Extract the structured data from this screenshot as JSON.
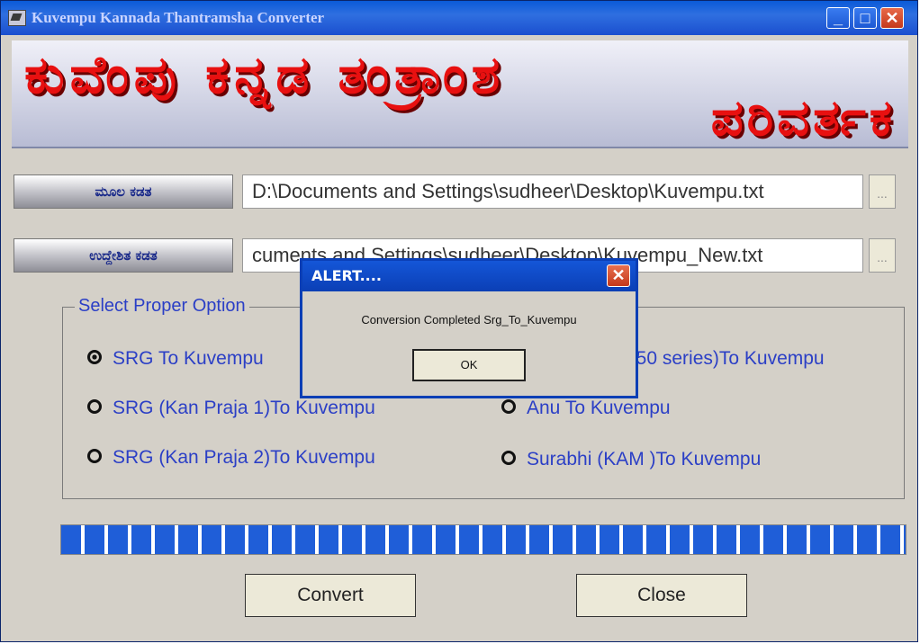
{
  "window": {
    "title": "Kuvempu Kannada Thantramsha Converter",
    "min_icon": "_",
    "max_icon": "□",
    "close_icon": "✕"
  },
  "banner": {
    "line1": "ಕುವೆಂಪು ಕನ್ನಡ ತಂತ್ರಾಂಶ",
    "line2": "ಪರಿವರ್ತಕ"
  },
  "source": {
    "label": "ಮೂಲ ಕಡತ",
    "value": "D:\\Documents and Settings\\sudheer\\Desktop\\Kuvempu.txt",
    "browse_label": "..."
  },
  "target": {
    "label": "ಉದ್ದೇಶಿತ ಕಡತ",
    "value": "cuments and Settings\\sudheer\\Desktop\\Kuvempu_New.txt",
    "browse_label": "..."
  },
  "options": {
    "legend": "Select Proper Option",
    "left": [
      {
        "label": "SRG To Kuvempu",
        "selected": true
      },
      {
        "label": "SRG (Kan Praja 1)To Kuvempu",
        "selected": false
      },
      {
        "label": "SRG (Kan Praja 2)To Kuvempu",
        "selected": false
      }
    ],
    "right": [
      {
        "label": "850 series)To Kuvempu",
        "selected": false
      },
      {
        "label": "Anu To Kuvempu",
        "selected": false
      },
      {
        "label": "Surabhi (KAM )To Kuvempu",
        "selected": false
      }
    ]
  },
  "progress": {
    "value_percent": 100,
    "color": "#1f5ed8"
  },
  "buttons": {
    "convert": "Convert",
    "close": "Close"
  },
  "alert": {
    "title": "ALERT....",
    "close_icon": "✕",
    "message": "Conversion Completed Srg_To_Kuvempu",
    "ok_label": "OK"
  },
  "colors": {
    "titlebar": "#0a5ad8",
    "banner_text": "#e81010",
    "option_text": "#2b3fc6"
  }
}
